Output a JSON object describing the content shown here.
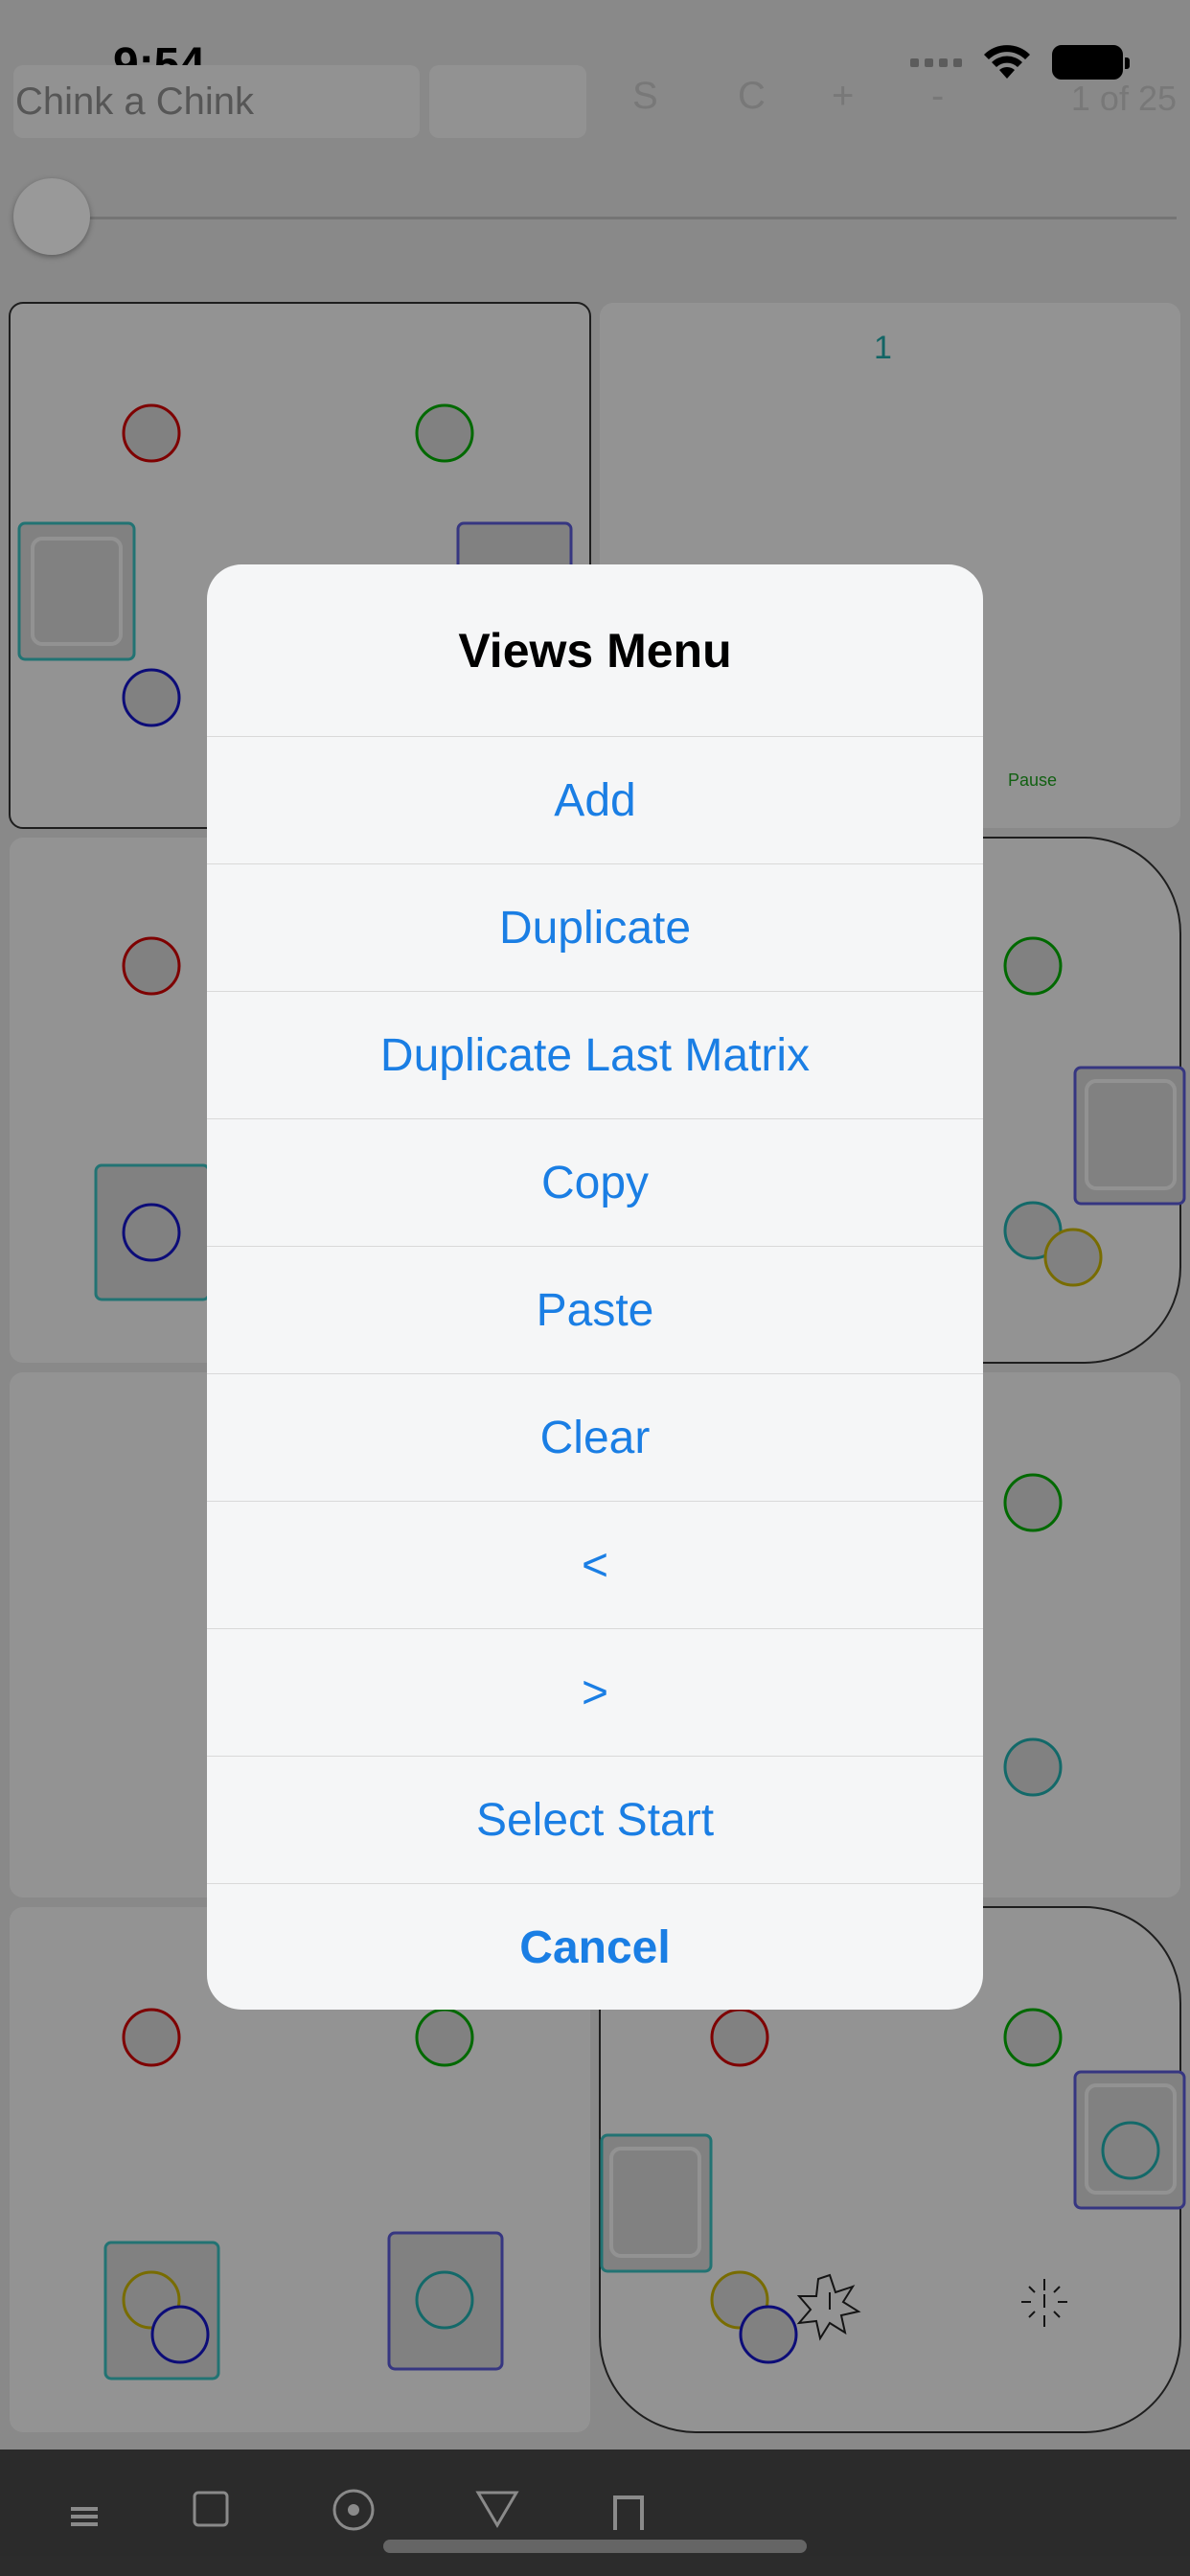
{
  "status_bar": {
    "time": "9:54",
    "icons": [
      "cellular-icon",
      "wifi-icon",
      "battery-icon"
    ]
  },
  "toolbar": {
    "title_field": "Chink a Chink",
    "buttons": [
      "S",
      "C",
      "+",
      "-"
    ],
    "page_indicator": "1 of 25"
  },
  "grid": {
    "cell_label": "1",
    "pause_label": "Pause"
  },
  "tab_bar": {
    "icons": [
      "menu-icon",
      "square-icon",
      "record-icon",
      "triangle-icon",
      "gate-icon"
    ]
  },
  "menu": {
    "title": "Views Menu",
    "items": [
      "Add",
      "Duplicate",
      "Duplicate Last Matrix",
      "Copy",
      "Paste",
      "Clear",
      "<",
      ">",
      "Select Start"
    ],
    "cancel": "Cancel"
  },
  "colors": {
    "accent": "#1a7ee4",
    "dim": "rgba(0,0,0,0.40)",
    "sheet_bg": "#f5f6f7"
  }
}
